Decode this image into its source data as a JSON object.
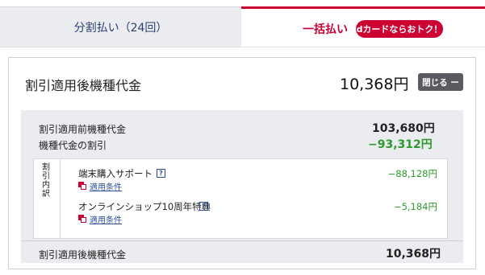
{
  "tabs": {
    "installment_label": "分割払い（24回）",
    "lump_label": "一括払い",
    "lump_badge": "dカードならおトク！"
  },
  "summary": {
    "title": "割引適用後機種代金",
    "amount": "10,368円",
    "close_button": "閉じる ー"
  },
  "details": {
    "before_discount_label": "割引適用前機種代金",
    "before_discount_value": "103,680円",
    "discount_label": "機種代金の割引",
    "discount_value": "−93,312円",
    "breakdown_label": "割引内訳",
    "items": [
      {
        "name": "端末購入サポート",
        "help": "?",
        "link": "適用条件",
        "amount": "−88,128円"
      },
      {
        "name": "オンラインショップ10周年特典",
        "help": "?",
        "link": "適用条件",
        "amount": "−5,184円"
      }
    ],
    "after_discount_label": "割引適用後機種代金",
    "after_discount_value": "10,368円"
  },
  "colors": {
    "accent_red": "#cc0033",
    "navy": "#2b3f76",
    "discount_green": "#2d9a2d",
    "panel_gray": "#ebecf0"
  }
}
